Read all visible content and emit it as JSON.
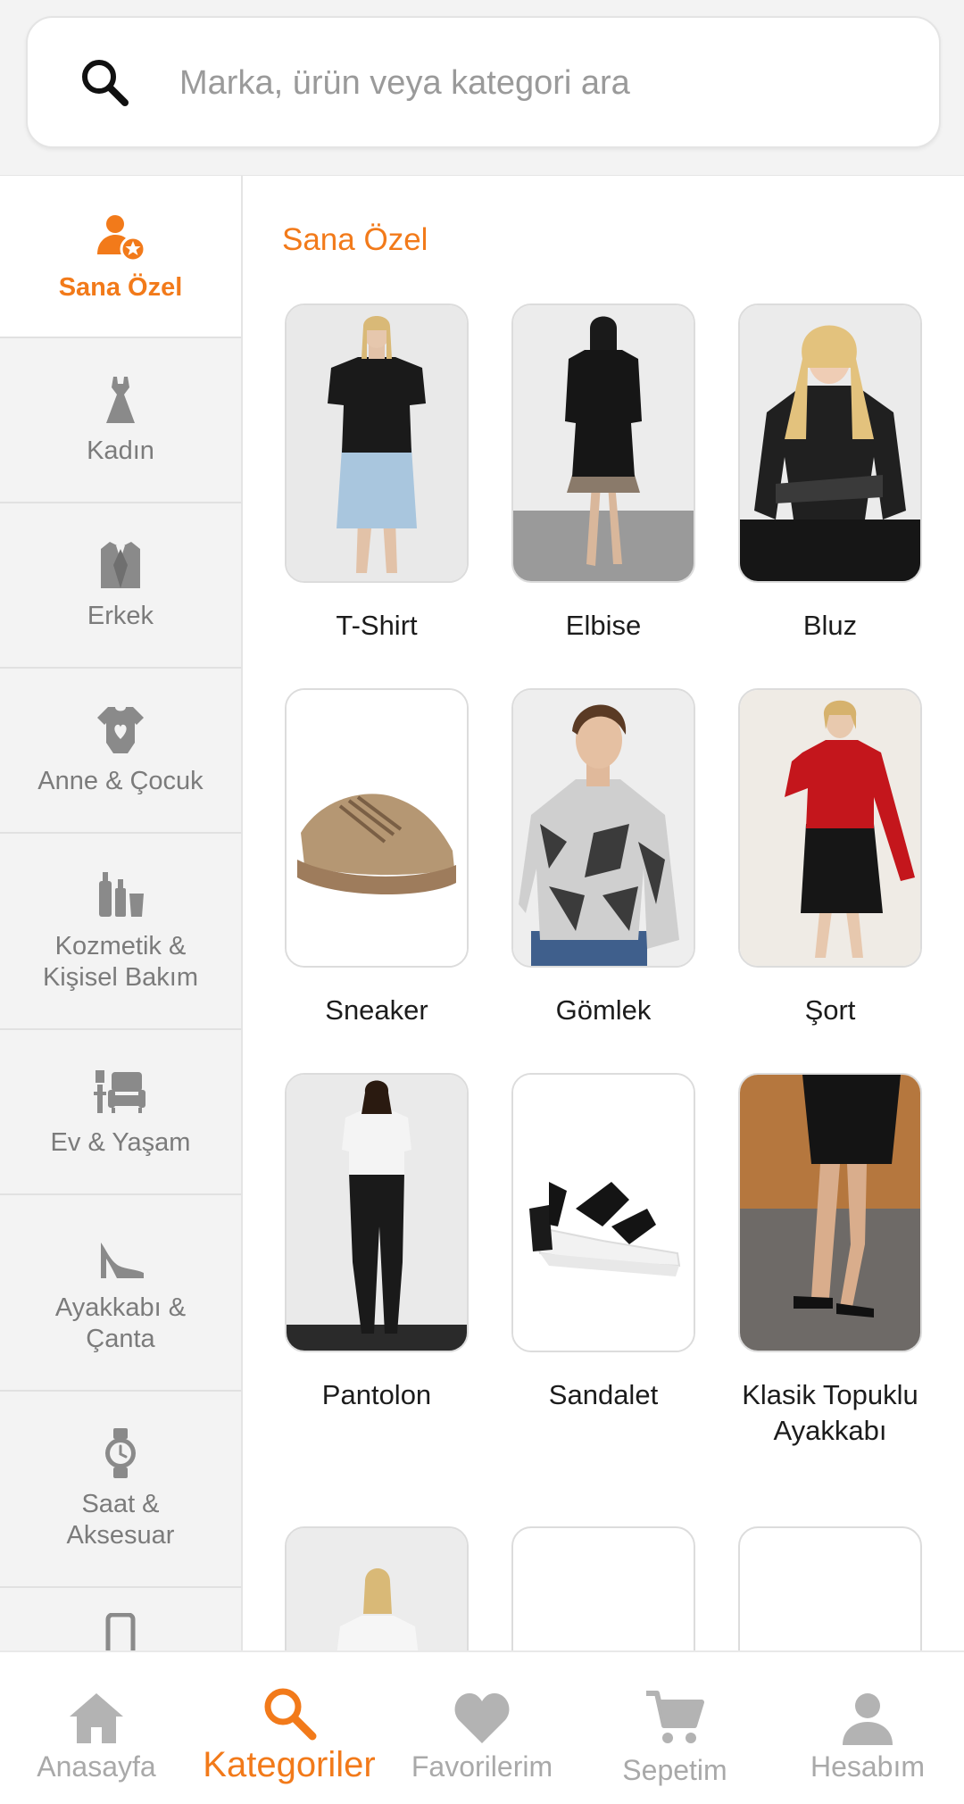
{
  "search": {
    "placeholder": "Marka, ürün veya kategori ara"
  },
  "sidebar": {
    "items": [
      {
        "label": "Sana Özel",
        "icon": "user-star-icon",
        "active": true
      },
      {
        "label": "Kadın",
        "icon": "dress-icon"
      },
      {
        "label": "Erkek",
        "icon": "suit-icon"
      },
      {
        "label": "Anne & Çocuk",
        "icon": "baby-onesie-icon"
      },
      {
        "label": "Kozmetik & Kişisel Bakım",
        "icon": "cosmetics-icon"
      },
      {
        "label": "Ev & Yaşam",
        "icon": "armchair-icon"
      },
      {
        "label": "Ayakkabı & Çanta",
        "icon": "high-heel-icon"
      },
      {
        "label": "Saat & Aksesuar",
        "icon": "watch-icon"
      },
      {
        "label": "",
        "icon": "phone-icon"
      }
    ]
  },
  "main": {
    "title": "Sana Özel",
    "tiles": [
      {
        "label": "T-Shirt"
      },
      {
        "label": "Elbise"
      },
      {
        "label": "Bluz"
      },
      {
        "label": "Sneaker"
      },
      {
        "label": "Gömlek"
      },
      {
        "label": "Şort"
      },
      {
        "label": "Pantolon"
      },
      {
        "label": "Sandalet"
      },
      {
        "label": "Klasik Topuklu Ayakkabı"
      },
      {
        "label": ""
      },
      {
        "label": ""
      },
      {
        "label": ""
      }
    ]
  },
  "bottom_nav": {
    "items": [
      {
        "label": "Anasayfa",
        "icon": "home-icon"
      },
      {
        "label": "Kategoriler",
        "icon": "search-icon",
        "active": true
      },
      {
        "label": "Favorilerim",
        "icon": "heart-icon"
      },
      {
        "label": "Sepetim",
        "icon": "cart-icon"
      },
      {
        "label": "Hesabım",
        "icon": "user-icon"
      }
    ]
  },
  "colors": {
    "accent": "#f27a1a",
    "inactive": "#7b7b7b",
    "background": "#f3f3f3"
  }
}
